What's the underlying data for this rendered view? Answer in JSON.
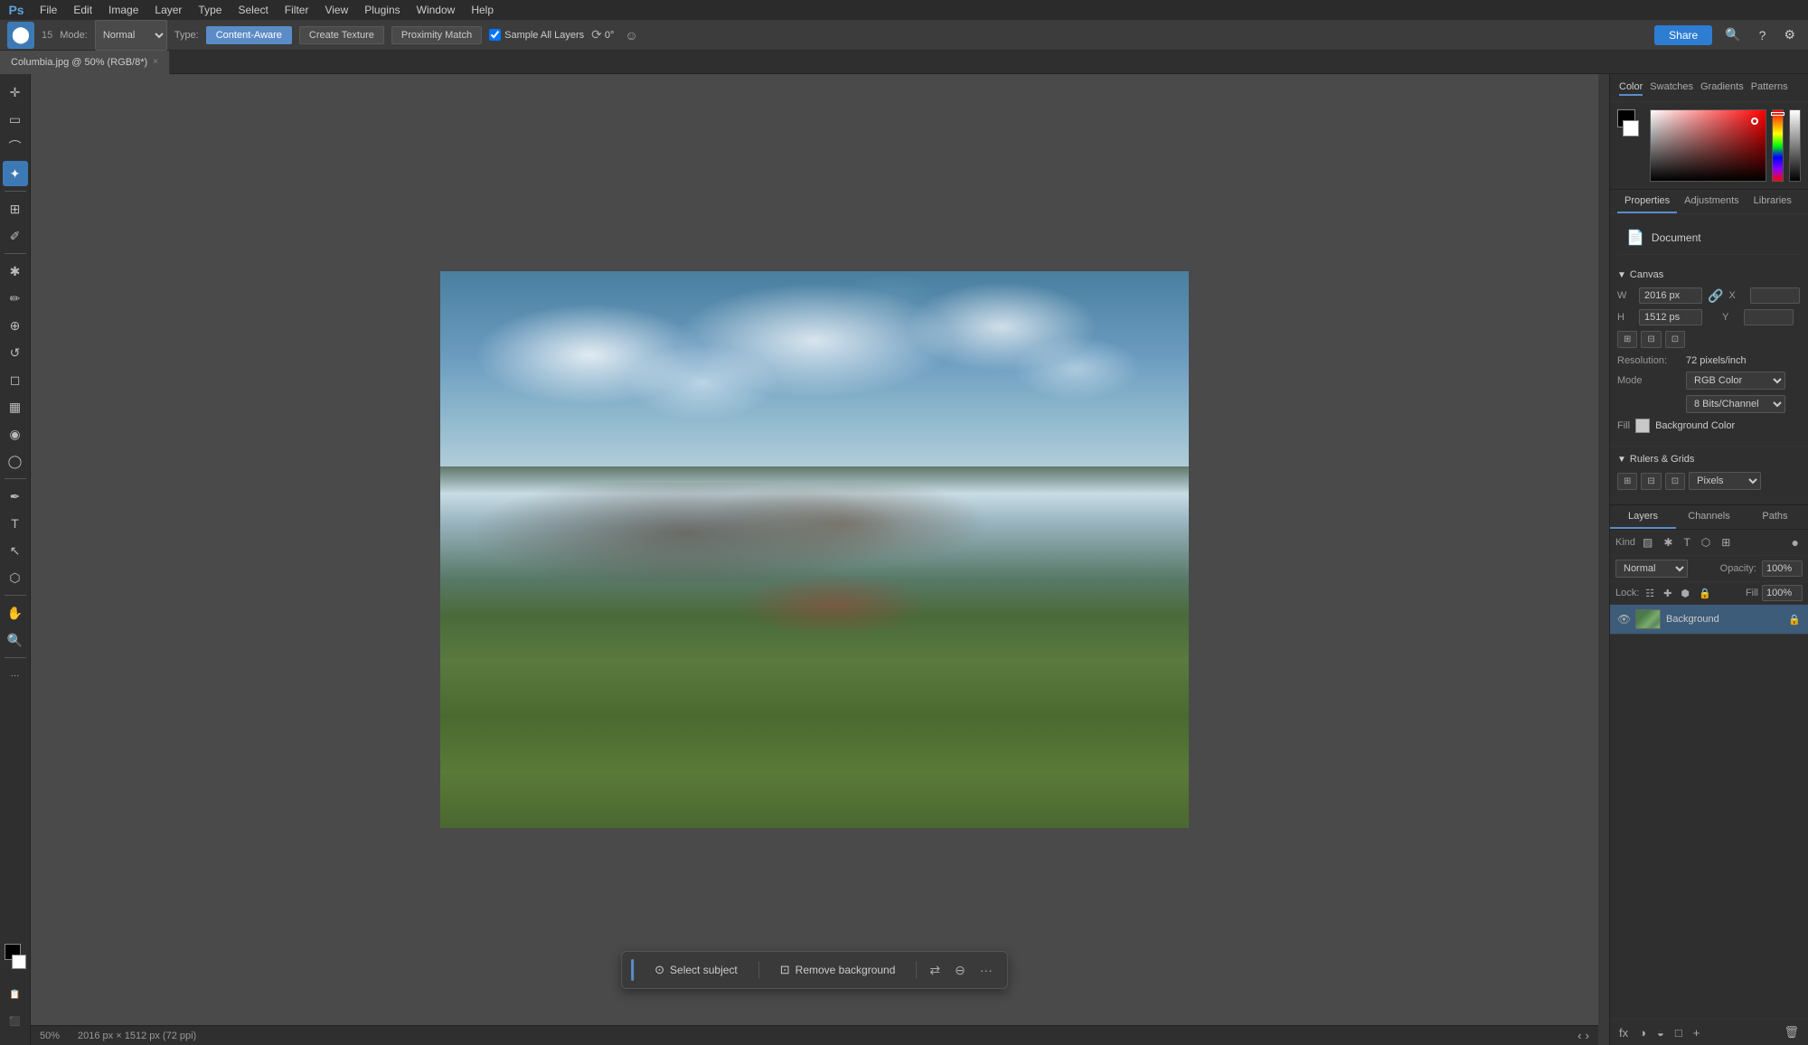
{
  "app": {
    "title": "Adobe Photoshop",
    "logo": "Ps"
  },
  "menu": {
    "items": [
      "File",
      "Edit",
      "Image",
      "Layer",
      "Type",
      "Select",
      "Filter",
      "View",
      "Plugins",
      "Window",
      "Help"
    ]
  },
  "options_bar": {
    "tool_icon": "⬤",
    "brush_size": "15",
    "mode_label": "Mode:",
    "mode_value": "Normal",
    "type_label": "Type:",
    "type_buttons": [
      "Content-Aware",
      "Create Texture",
      "Proximity Match"
    ],
    "active_type": "Content-Aware",
    "sample_all_label": "Sample All Layers",
    "angle_label": "0°",
    "share_label": "Share"
  },
  "tab": {
    "title": "Columbia.jpg @ 50% (RGB/8*)",
    "close": "×"
  },
  "tools": [
    {
      "name": "move",
      "icon": "✛"
    },
    {
      "name": "select-rect",
      "icon": "▭"
    },
    {
      "name": "lasso",
      "icon": "⌒"
    },
    {
      "name": "magic-wand",
      "icon": "✦"
    },
    {
      "name": "crop",
      "icon": "⊞"
    },
    {
      "name": "eyedropper",
      "icon": "✐"
    },
    {
      "name": "healing",
      "icon": "✱"
    },
    {
      "name": "brush",
      "icon": "✏"
    },
    {
      "name": "clone-stamp",
      "icon": "⊕"
    },
    {
      "name": "history-brush",
      "icon": "↺"
    },
    {
      "name": "eraser",
      "icon": "◻"
    },
    {
      "name": "gradient",
      "icon": "▦"
    },
    {
      "name": "blur",
      "icon": "◉"
    },
    {
      "name": "dodge",
      "icon": "◯"
    },
    {
      "name": "pen",
      "icon": "✒"
    },
    {
      "name": "type",
      "icon": "T"
    },
    {
      "name": "path-select",
      "icon": "↖"
    },
    {
      "name": "shape",
      "icon": "⬡"
    },
    {
      "name": "hand",
      "icon": "✋"
    },
    {
      "name": "zoom",
      "icon": "🔍"
    },
    {
      "name": "more",
      "icon": "···"
    }
  ],
  "canvas": {
    "zoom": "50%",
    "dimensions": "2016 px × 1512 px (72 ppi)",
    "status": "50%"
  },
  "floating_toolbar": {
    "select_subject_label": "Select subject",
    "remove_bg_label": "Remove background",
    "more_icon": "···"
  },
  "color_panel": {
    "tabs": [
      "Color",
      "Swatches",
      "Gradients",
      "Patterns"
    ],
    "active_tab": "Color"
  },
  "properties_panel": {
    "tabs": [
      "Properties",
      "Adjustments",
      "Libraries"
    ],
    "active_tab": "Properties",
    "document_label": "Document",
    "canvas_section": "Canvas",
    "width_label": "W",
    "width_value": "2016 px",
    "height_label": "H",
    "height_value": "1512 ps",
    "x_label": "X",
    "y_label": "Y",
    "resolution_label": "Resolution:",
    "resolution_value": "72 pixels/inch",
    "mode_label": "Mode",
    "mode_value": "RGB Color",
    "bits_value": "8 Bits/Channel",
    "fill_label": "Fill",
    "fill_value": "Background Color",
    "rulers_section": "Rulers & Grids",
    "rulers_unit": "Pixels"
  },
  "layers_panel": {
    "tabs": [
      "Layers",
      "Channels",
      "Paths"
    ],
    "active_tab": "Layers",
    "blend_mode": "Normal",
    "opacity_label": "Opacity:",
    "opacity_value": "100%",
    "lock_label": "Lock:",
    "fill_label": "Fill",
    "fill_value": "100%",
    "layers": [
      {
        "name": "Background",
        "visible": true,
        "locked": true,
        "type": "image"
      }
    ]
  },
  "status_bar": {
    "zoom": "50%",
    "dimensions": "2016 px × 1512 px (72 ppi)"
  }
}
